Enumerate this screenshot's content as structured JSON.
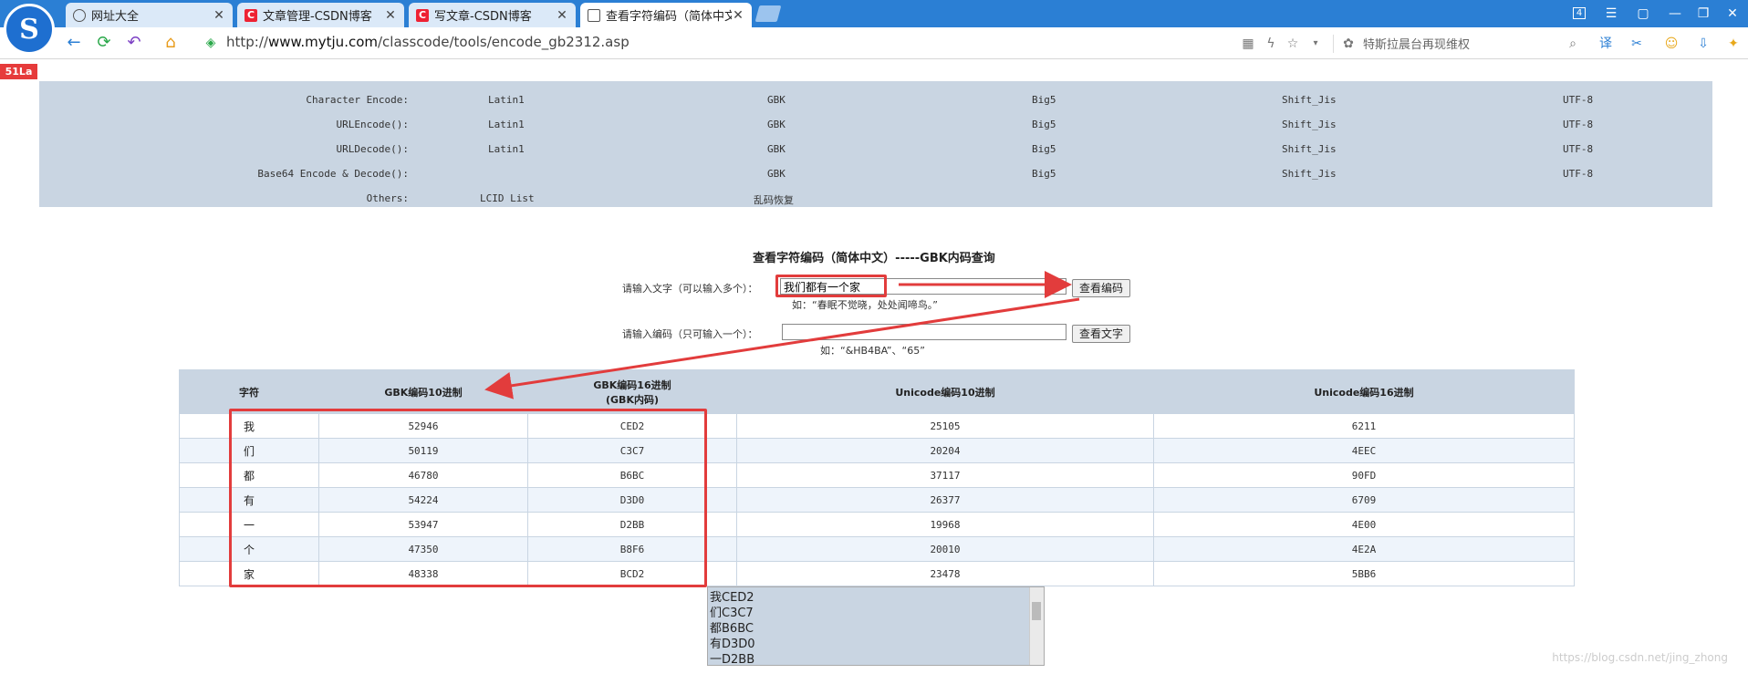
{
  "browser": {
    "tabs": [
      {
        "label": "网址大全",
        "icon": "globe-icon"
      },
      {
        "label": "文章管理-CSDN博客",
        "icon": "csdn-icon"
      },
      {
        "label": "写文章-CSDN博客",
        "icon": "csdn-icon"
      },
      {
        "label": "查看字符编码（简体中文",
        "icon": "page-icon",
        "active": true
      }
    ],
    "tab_count": "4",
    "url_prefix": "http://",
    "url_domain": "www.mytju.com",
    "url_path": "/classcode/tools/encode_gb2312.asp",
    "search_hint": "特斯拉晨台再现维权"
  },
  "site": {
    "badge": "51La",
    "nav_rows": [
      {
        "label": "Character Encode:",
        "cells": [
          "Latin1",
          "GBK",
          "Big5",
          "Shift_Jis",
          "UTF-8"
        ]
      },
      {
        "label": "URLEncode():",
        "cells": [
          "Latin1",
          "GBK",
          "Big5",
          "Shift_Jis",
          "UTF-8"
        ]
      },
      {
        "label": "URLDecode():",
        "cells": [
          "Latin1",
          "GBK",
          "Big5",
          "Shift_Jis",
          "UTF-8"
        ]
      },
      {
        "label": "Base64 Encode & Decode():",
        "cells": [
          "",
          "GBK",
          "Big5",
          "Shift_Jis",
          "UTF-8"
        ]
      },
      {
        "label": "Others:",
        "cells": [
          "LCID List",
          "乱码恢复",
          "",
          "",
          ""
        ]
      }
    ]
  },
  "tool": {
    "title": "查看字符编码（简体中文）-----GBK内码查询",
    "text_label": "请输入文字（可以输入多个）：",
    "text_value": "我们都有一个家",
    "text_button": "查看编码",
    "text_hint": "如：“春眠不觉晓，处处闻啼鸟。”",
    "code_label": "请输入编码（只可输入一个）：",
    "code_value": "",
    "code_button": "查看文字",
    "code_hint": "如：“&HB4BA”、“65”"
  },
  "results": {
    "headers": [
      "字符",
      "GBK编码10进制",
      "GBK编码16进制",
      "(GBK内码)",
      "Unicode编码10进制",
      "Unicode编码16进制"
    ],
    "rows": [
      {
        "char": "我",
        "gbk10": "52946",
        "gbk16": "CED2",
        "uni10": "25105",
        "uni16": "6211"
      },
      {
        "char": "们",
        "gbk10": "50119",
        "gbk16": "C3C7",
        "uni10": "20204",
        "uni16": "4EEC"
      },
      {
        "char": "都",
        "gbk10": "46780",
        "gbk16": "B6BC",
        "uni10": "37117",
        "uni16": "90FD"
      },
      {
        "char": "有",
        "gbk10": "54224",
        "gbk16": "D3D0",
        "uni10": "26377",
        "uni16": "6709"
      },
      {
        "char": "一",
        "gbk10": "53947",
        "gbk16": "D2BB",
        "uni10": "19968",
        "uni16": "4E00"
      },
      {
        "char": "个",
        "gbk10": "47350",
        "gbk16": "B8F6",
        "uni10": "20010",
        "uni16": "4E2A"
      },
      {
        "char": "家",
        "gbk10": "48338",
        "gbk16": "BCD2",
        "uni10": "23478",
        "uni16": "5BB6"
      }
    ],
    "output_lines": [
      "我CED2",
      "们C3C7",
      "都B6BC",
      "有D3D0",
      "一D2BB"
    ]
  },
  "watermark": "https://blog.csdn.net/jing_zhong",
  "colors": {
    "accent": "#2b7fd4",
    "panel": "#c9d5e2",
    "annotation": "#e23c3c"
  }
}
